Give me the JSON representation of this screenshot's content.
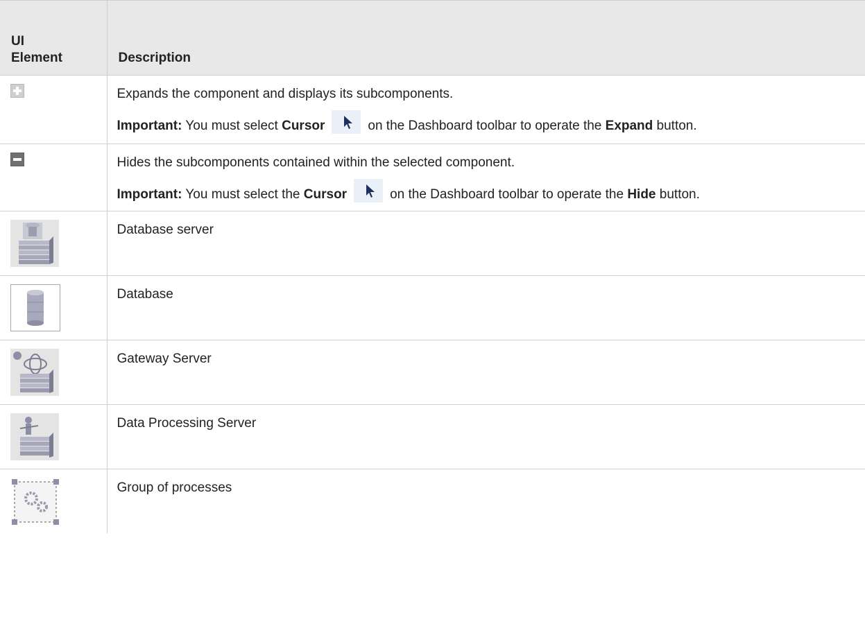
{
  "header": {
    "col1": "UI Element",
    "col1_line1": "UI",
    "col1_line2": "Element",
    "col2": "Description"
  },
  "rows": [
    {
      "icon": "expand-plus-icon",
      "text": "Expands the component and displays its subcomponents.",
      "note_label": "Important:",
      "note_pre": "You must select",
      "note_bold1": "Cursor",
      "note_icon": "cursor-arrow-icon",
      "note_mid": "on the Dashboard toolbar to operate the",
      "note_bold2": "Expand",
      "note_end": "button."
    },
    {
      "icon": "hide-minus-icon",
      "text": "Hides the subcomponents contained within the selected component.",
      "note_label": "Important:",
      "note_pre": "You must select the",
      "note_bold1": "Cursor",
      "note_icon": "cursor-arrow-icon",
      "note_mid": "on the Dashboard toolbar to operate the",
      "note_bold2": "Hide",
      "note_end": "button."
    },
    {
      "icon": "database-server-icon",
      "text": "Database server"
    },
    {
      "icon": "database-icon",
      "text": "Database"
    },
    {
      "icon": "gateway-server-icon",
      "text": "Gateway Server"
    },
    {
      "icon": "data-processing-server-icon",
      "text": "Data Processing Server"
    },
    {
      "icon": "group-of-processes-icon",
      "text": "Group of processes"
    }
  ],
  "colors": {
    "header_bg": "#e8e8e8",
    "border": "#cfcfcf",
    "icon_gray": "#6e6e6e",
    "cursor_bg": "#e9f0f7",
    "cursor_arrow": "#1f2f5c"
  }
}
